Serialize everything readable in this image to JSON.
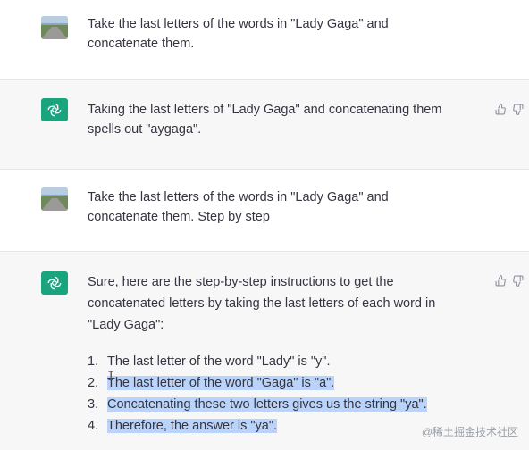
{
  "messages": [
    {
      "role": "user",
      "text_line1": "Take the last letters of the words in \"Lady Gaga\" and",
      "text_line2": "concatenate them."
    },
    {
      "role": "assistant",
      "text_line1": "Taking the last letters of \"Lady Gaga\" and concatenating them",
      "text_line2": "spells out \"aygaga\"."
    },
    {
      "role": "user",
      "text_line1": "Take the last letters of the words in \"Lady Gaga\" and",
      "text_line2": "concatenate them. Step by step"
    },
    {
      "role": "assistant",
      "intro_line1": "Sure, here are the step-by-step instructions to get the",
      "intro_line2": "concatenated letters by taking the last letters of each word in",
      "intro_line3": "\"Lady Gaga\":",
      "steps": [
        {
          "num": "1.",
          "text": "The last letter of the word \"Lady\" is \"y\"."
        },
        {
          "num": "2.",
          "text": "The last letter of the word \"Gaga\" is \"a\"."
        },
        {
          "num": "3.",
          "text": "Concatenating these two letters gives us the string \"ya\"."
        },
        {
          "num": "4.",
          "text": "Therefore, the answer is \"ya\"."
        }
      ]
    }
  ],
  "icons": {
    "user_avatar": "user-photo",
    "assistant_avatar": "openai-logo-icon",
    "thumbs_up": "thumbs-up-icon",
    "thumbs_down": "thumbs-down-icon"
  },
  "colors": {
    "assistant_bg": "#f7f7f8",
    "bot_avatar": "#19a47e",
    "highlight": "#b9d3fb"
  },
  "watermark": "@稀土掘金技术社区"
}
